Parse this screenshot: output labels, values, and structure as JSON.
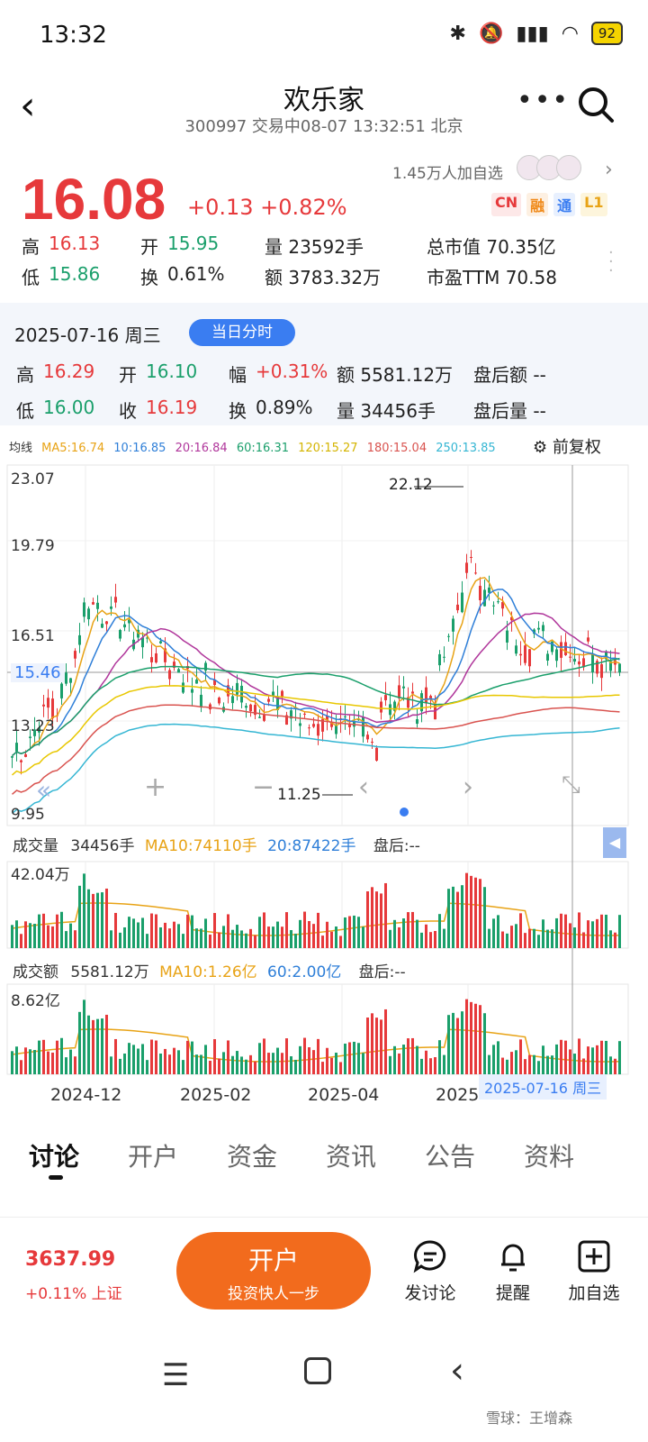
{
  "status": {
    "time": "13:32",
    "battery": "92"
  },
  "nav": {
    "title": "欢乐家",
    "subtitle": "300997 交易中08-07 13:32:51 北京"
  },
  "quote": {
    "price": "16.08",
    "change": "+0.13 +0.82%",
    "followers": "1.45万人加自选",
    "tags": [
      "CN",
      "融",
      "通",
      "L1"
    ],
    "rows": [
      [
        "高",
        "16.13",
        "开",
        "15.95",
        "量 23592手",
        "总市值 70.35亿"
      ],
      [
        "低",
        "15.86",
        "换",
        "0.61%",
        "额 3783.32万",
        "市盈TTM 70.58"
      ]
    ]
  },
  "day": {
    "date": "2025-07-16 周三",
    "pill": "当日分时",
    "high_label": "高",
    "high": "16.29",
    "open_label": "开",
    "open": "16.10",
    "amp_label": "幅",
    "amp": "+0.31%",
    "amt": "额 5581.12万",
    "after_amt": "盘后额 --",
    "low_label": "低",
    "low": "16.00",
    "close_label": "收",
    "close": "16.19",
    "turn_label": "换",
    "turn": "0.89%",
    "vol": "量 34456手",
    "after_vol": "盘后量 --"
  },
  "ma_bar": {
    "label": "均线",
    "items": [
      {
        "text": "MA5:16.74",
        "color": "#e8a316"
      },
      {
        "text": "10:16.85",
        "color": "#2f7fd8"
      },
      {
        "text": "20:16.84",
        "color": "#b0369b"
      },
      {
        "text": "60:16.31",
        "color": "#1a9f6b"
      },
      {
        "text": "120:15.27",
        "color": "#e8c700"
      },
      {
        "text": "180:15.04",
        "color": "#d9534f"
      },
      {
        "text": "250:13.85",
        "color": "#35b6d3"
      }
    ],
    "adjust": "前复权"
  },
  "kline": {
    "y_ticks": [
      "23.07",
      "19.79",
      "16.51",
      "13.23",
      "9.95"
    ],
    "current": "15.46",
    "max_label": "22.12",
    "min_label": "11.25"
  },
  "volume_panel": {
    "label": "成交量",
    "value": "34456手",
    "ma10": "MA10:74110手",
    "ma20": "20:87422手",
    "after": "盘后:--",
    "max": "42.04万"
  },
  "amount_panel": {
    "label": "成交额",
    "value": "5581.12万",
    "ma10": "MA10:1.26亿",
    "ma60": "60:2.00亿",
    "after": "盘后:--",
    "max": "8.62亿"
  },
  "x_axis": [
    "2024-12",
    "2025-02",
    "2025-04",
    "2025"
  ],
  "date_badge": "2025-07-16 周三",
  "tabs": [
    "讨论",
    "开户",
    "资金",
    "资讯",
    "公告",
    "资料"
  ],
  "bottom": {
    "index_value": "3637.99",
    "index_change": "+0.11% 上证",
    "open_title": "开户",
    "open_sub": "投资快人一步",
    "actions": [
      "发讨论",
      "提醒",
      "加自选"
    ]
  },
  "watermark": "雪球：王增森",
  "colors": {
    "up": "#e6393b",
    "down": "#1a9f6b",
    "accent": "#3a7df1",
    "cta": "#f26b1d"
  }
}
